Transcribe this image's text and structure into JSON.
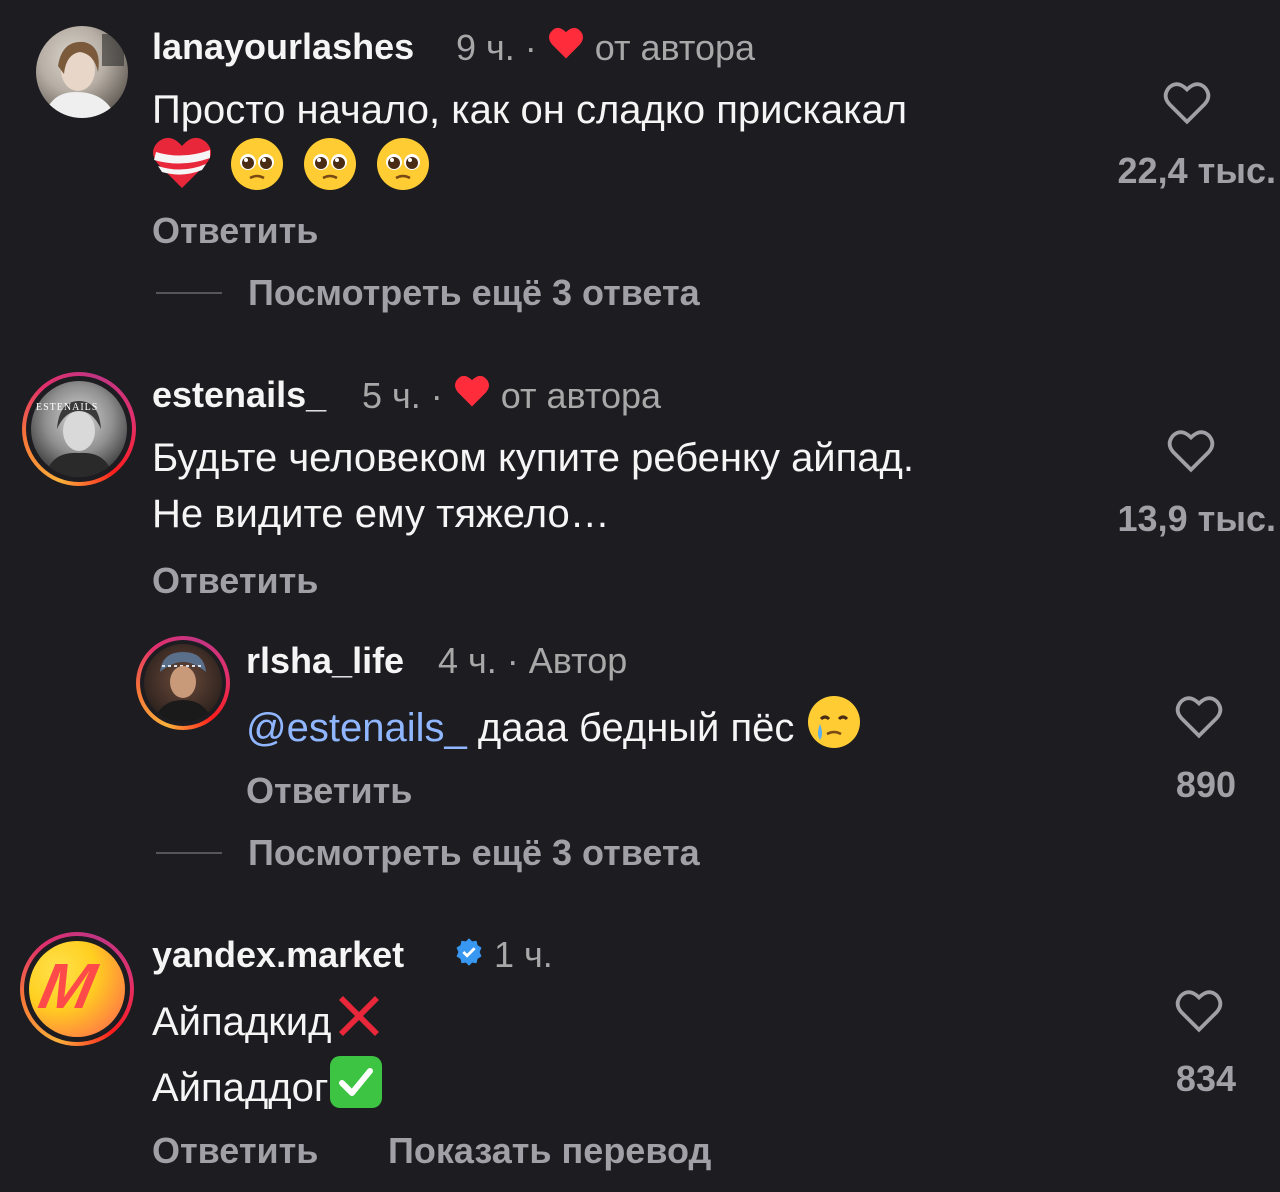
{
  "comments": [
    {
      "username": "lanayourlashes",
      "time": "9 ч.",
      "separator": "·",
      "liked_by_author": "от автора",
      "text_line1": "Просто начало, как он сладко прискакал",
      "likes": "22,4 тыс.",
      "reply_label": "Ответить",
      "view_more": "Посмотреть ещё 3 ответа",
      "icons": [
        "mending-heart-icon",
        "pleading-face-icon",
        "pleading-face-icon",
        "pleading-face-icon"
      ]
    },
    {
      "username": "estenails_",
      "avatar_text": "ESTENAILS",
      "time": "5 ч.",
      "separator": "·",
      "liked_by_author": "от автора",
      "text_line1": "Будьте человеком купите ребенку айпад.",
      "text_line2": "Не видите ему тяжело…",
      "likes": "13,9 тыс.",
      "reply_label": "Ответить"
    },
    {
      "username": "rlsha_life",
      "time": "4 ч.",
      "separator": "·",
      "author_badge": "Автор",
      "mention": "@estenails_",
      "text": "дааа бедный пёс",
      "likes": "890",
      "reply_label": "Ответить",
      "view_more": "Посмотреть ещё 3 ответа",
      "icons": [
        "face-holding-back-tears-icon"
      ]
    },
    {
      "username": "yandex.market",
      "avatar_text": "M",
      "time": "1 ч.",
      "text_line1": "Айпадкид",
      "text_line2": "Айпаддог",
      "likes": "834",
      "reply_label": "Ответить",
      "translate_label": "Показать перевод",
      "icons": [
        "cross-mark-icon",
        "check-mark-button-icon",
        "verified-badge-icon"
      ]
    }
  ],
  "colors": {
    "background": "#1c1c21",
    "author_heart": "#ff2d3b",
    "mention": "#8fb6ff",
    "verified": "#3897f0",
    "secondary_text": "#a8a8a8"
  }
}
